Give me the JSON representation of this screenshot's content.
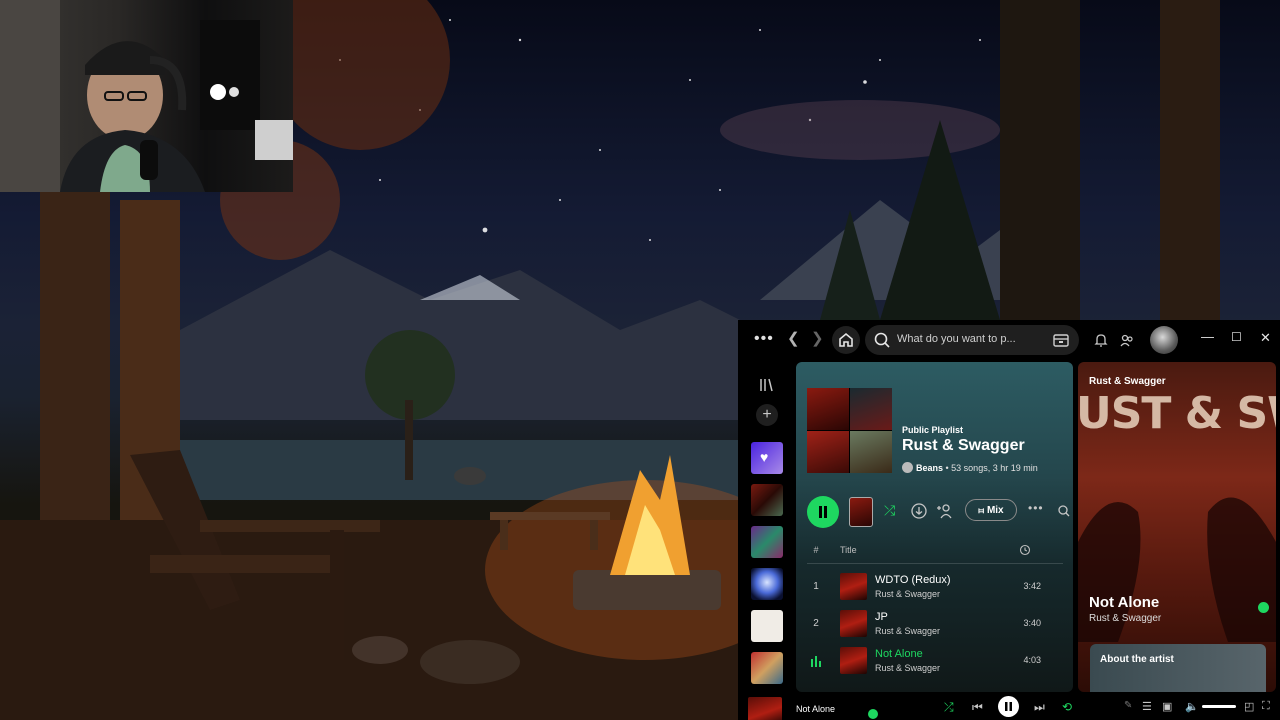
{
  "topbar": {
    "menu_icon": "more-dots-icon",
    "search_placeholder": "What do you want to p...",
    "window_controls": [
      "minimize",
      "maximize",
      "close"
    ]
  },
  "left_nav": {
    "library_icon": "library-icon",
    "add_icon": "plus-icon"
  },
  "playlist": {
    "type_label": "Public Playlist",
    "title": "Rust & Swagger",
    "owner": "Beans",
    "meta": " • 53 songs, 3 hr 19 min",
    "mix_label": "Mix"
  },
  "tracklist": {
    "header_num": "#",
    "header_title": "Title",
    "rows": [
      {
        "num": "1",
        "title": "WDTO (Redux)",
        "artist": "Rust & Swagger",
        "duration": "3:42",
        "playing": false
      },
      {
        "num": "2",
        "title": "JP",
        "artist": "Rust & Swagger",
        "duration": "3:40",
        "playing": false
      },
      {
        "num": "",
        "title": "Not Alone",
        "artist": "Rust & Swagger",
        "duration": "4:03",
        "playing": true
      }
    ]
  },
  "now_playing_panel": {
    "header": "Rust & Swagger",
    "cover_text": "UST & SWAGG",
    "track": "Not Alone",
    "artist": "Rust & Swagger",
    "about_label": "About the artist"
  },
  "player": {
    "track": "Not Alone"
  },
  "colors": {
    "accent": "#1ed760",
    "background": "#000000",
    "playlist_header": "#2d5c63",
    "panel_red": "#7d2818"
  }
}
